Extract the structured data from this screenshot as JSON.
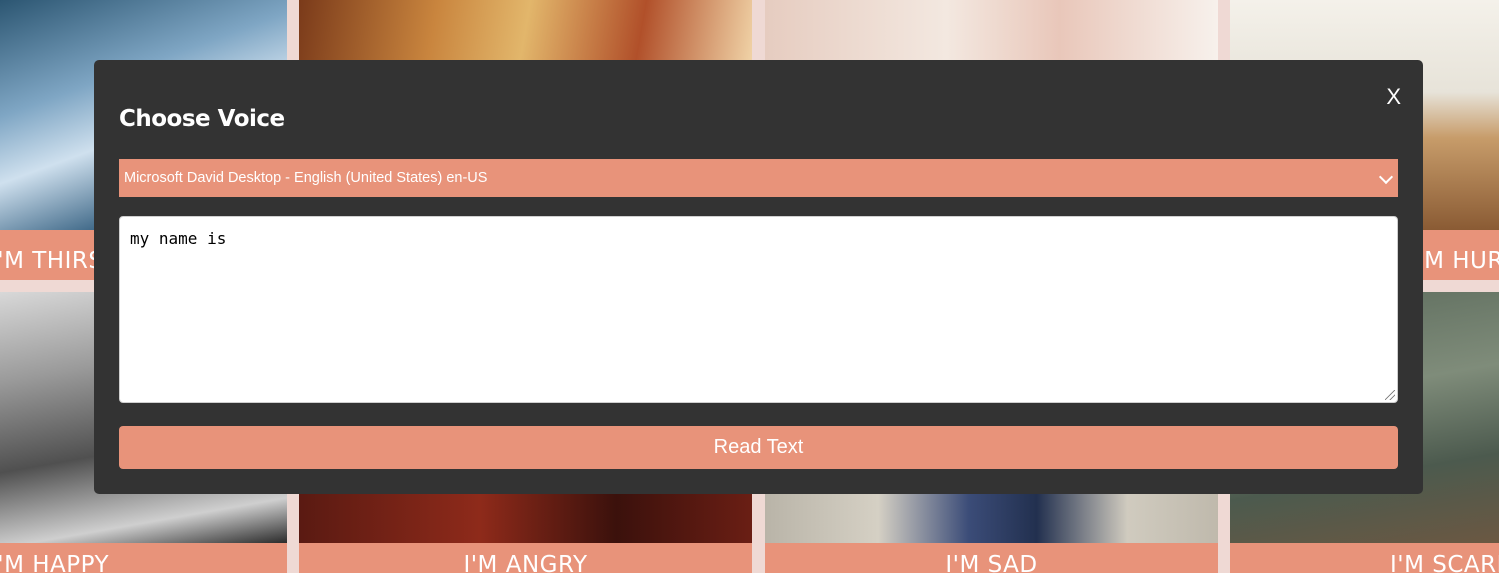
{
  "background_cards": [
    {
      "label": "I'M THIRSTY"
    },
    {
      "label": ""
    },
    {
      "label": ""
    },
    {
      "label": "I'M HURT"
    },
    {
      "label": "I'M HAPPY"
    },
    {
      "label": "I'M ANGRY"
    },
    {
      "label": "I'M SAD"
    },
    {
      "label": "I'M SCARED"
    }
  ],
  "modal": {
    "title": "Choose Voice",
    "close_label": "X",
    "voice_select": {
      "selected": "Microsoft David Desktop - English (United States) en-US"
    },
    "text_input": {
      "value": "my name is"
    },
    "read_button_label": "Read Text"
  },
  "colors": {
    "accent": "#e8937a",
    "modal_bg": "#333333"
  },
  "icons": [
    "chevron-down-icon",
    "resize-handle-icon"
  ]
}
